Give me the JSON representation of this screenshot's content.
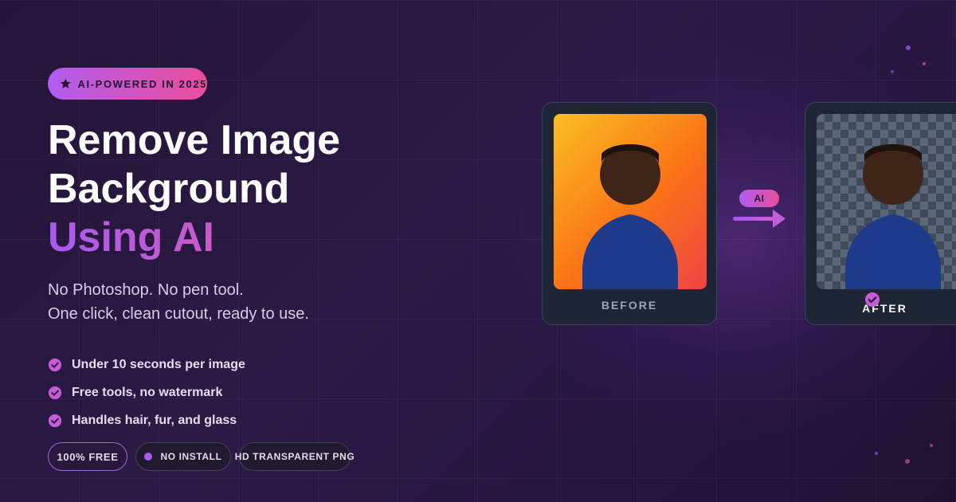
{
  "badge": {
    "label": "AI-POWERED IN 2025",
    "icon": "star-icon"
  },
  "headline": {
    "line1": "Remove Image",
    "line2": "Background",
    "line3": "Using AI"
  },
  "subtitle": {
    "line1": "No Photoshop. No pen tool.",
    "line2": "One click, clean cutout, ready to use."
  },
  "features": [
    {
      "icon": "check-circle-icon",
      "label": "Under 10 seconds per image"
    },
    {
      "icon": "check-circle-icon",
      "label": "Free tools, no watermark"
    },
    {
      "icon": "check-circle-icon",
      "label": "Handles hair, fur, and glass"
    }
  ],
  "pills": [
    {
      "label": "100% FREE"
    },
    {
      "label": "NO INSTALL",
      "icon": "dot-icon"
    },
    {
      "label": "HD TRANSPARENT PNG"
    }
  ],
  "comparison": {
    "before_label": "BEFORE",
    "after_label": "AFTER",
    "ai_chip": "AI",
    "arrow_icon": "arrow-right-icon"
  },
  "colors": {
    "background": "#241538",
    "accent_purple": "#a85bf0",
    "accent_pink": "#e35aa8",
    "card": "#1e2636",
    "shirt": "#1e3a8a",
    "skin": "#3f2518"
  }
}
